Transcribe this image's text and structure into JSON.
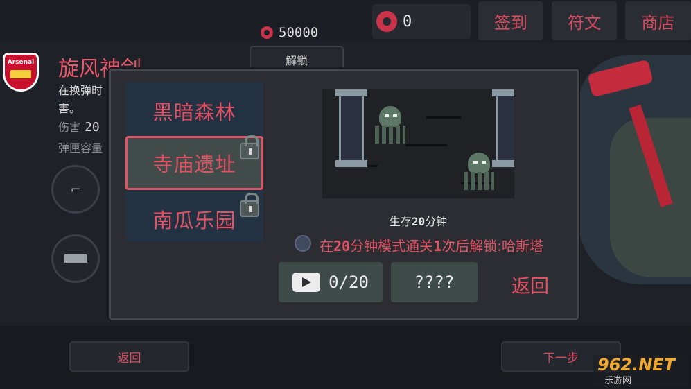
{
  "topbar": {
    "currency_value": "0",
    "gold_value": "50000",
    "buttons": [
      "签到",
      "符文",
      "商店"
    ],
    "unlock_tab": "解锁"
  },
  "weapon": {
    "name": "旋风神剑",
    "desc_line1": "在换弹时",
    "desc_line2": "害。",
    "damage_label": "伤害",
    "damage_value": "20",
    "mag_label": "弹匣容量"
  },
  "bottom_nav": {
    "back": "返回",
    "next": "下一步"
  },
  "dialog": {
    "maps": [
      {
        "name": "黑暗森林",
        "locked": false,
        "selected": false
      },
      {
        "name": "寺庙遗址",
        "locked": true,
        "selected": true
      },
      {
        "name": "南瓜乐园",
        "locked": true,
        "selected": false
      }
    ],
    "survive_pre": "生存",
    "survive_num": "20",
    "survive_post": "分钟",
    "condition_a": "在",
    "condition_n1": "20",
    "condition_b": "分钟模式通关",
    "condition_n2": "1",
    "condition_c": "次后解锁:哈斯塔",
    "watch_count": "0/20",
    "unknown": "????",
    "back": "返回"
  },
  "watermark": {
    "main": "962.NET",
    "sub": "乐游网"
  },
  "logo_text": "Arsenal",
  "colors": {
    "accent": "#e05264",
    "panel": "#2b2d32",
    "map_list": "#223242",
    "button": "#3f4b48"
  }
}
